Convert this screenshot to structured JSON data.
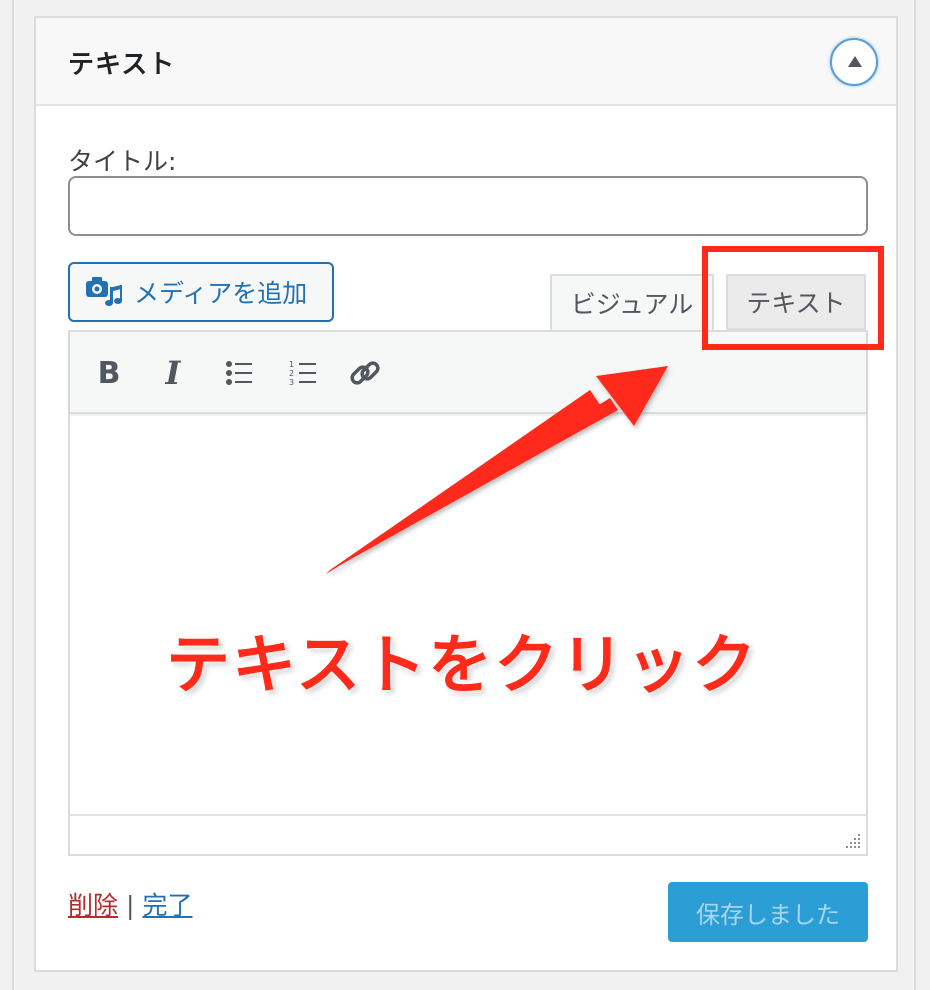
{
  "widget": {
    "title": "テキスト",
    "title_label": "タイトル:",
    "title_value": "",
    "media_button": "メディアを追加",
    "tabs": {
      "visual": "ビジュアル",
      "text": "テキスト"
    },
    "toolbar": {
      "bold": "B",
      "italic": "I"
    },
    "actions": {
      "delete": "削除",
      "separator": "|",
      "done": "完了"
    },
    "save_button": "保存しました"
  },
  "annotation": {
    "text": "テキストをクリック",
    "color": "#ff2a1a"
  },
  "colors": {
    "accent": "#2271b1",
    "save_bg": "#2c9ed6",
    "delete": "#b32d2e"
  }
}
